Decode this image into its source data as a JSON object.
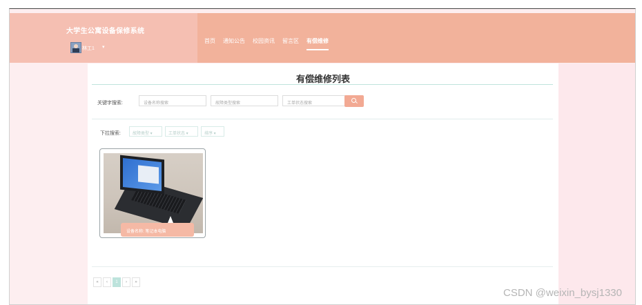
{
  "header": {
    "site_title": "大学生公寓设备保修系统",
    "username": "林工1",
    "caret": "▾",
    "nav": [
      "首页",
      "通知公告",
      "校园资讯",
      "留言区",
      "有偿维修"
    ],
    "active_nav": "有偿维修"
  },
  "main": {
    "page_title": "有偿维修列表",
    "search": {
      "label": "关键字搜索:",
      "inputs": [
        {
          "placeholder": "设备名称搜索"
        },
        {
          "placeholder": "故障类型搜索"
        },
        {
          "placeholder": "工单状态搜索"
        }
      ],
      "button_icon": "search-icon"
    },
    "filter": {
      "label": "下拉搜索:",
      "dropdowns": [
        "故障类型 ▾",
        "工单状态 ▾",
        "排序 ▾"
      ]
    },
    "cards": [
      {
        "caption": "设备名称: 笔记本电脑",
        "image": "laptop-photo"
      }
    ],
    "pagination": {
      "items": [
        "«",
        "‹",
        "1",
        "›",
        "»"
      ],
      "current": "1"
    }
  },
  "watermark": "CSDN @weixin_bysj1330",
  "colors": {
    "header": "#f2b29b",
    "header_left": "#f5bfb2",
    "accent": "#f2a993",
    "side": "#fdeef0",
    "teal_line": "#bfe3dc"
  }
}
